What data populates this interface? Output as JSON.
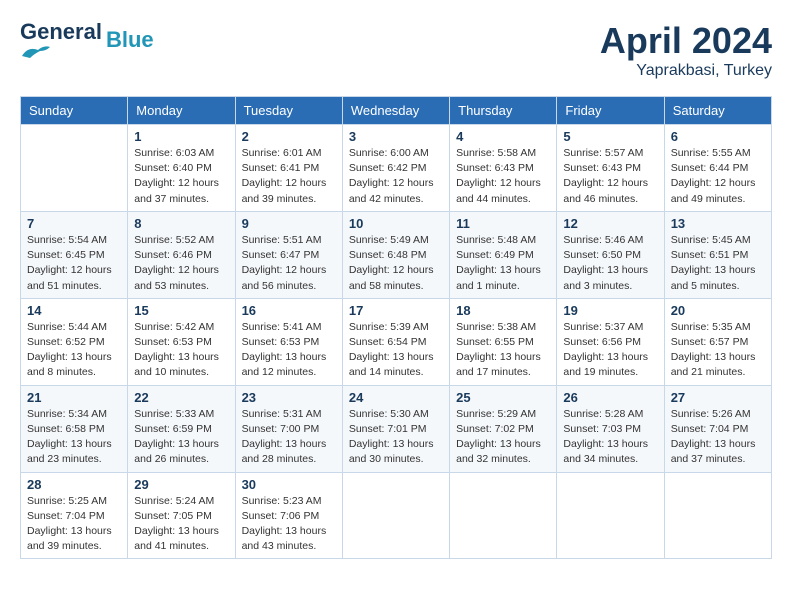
{
  "header": {
    "logo_line1": "General",
    "logo_line2": "Blue",
    "month": "April 2024",
    "location": "Yaprakbasi, Turkey"
  },
  "weekdays": [
    "Sunday",
    "Monday",
    "Tuesday",
    "Wednesday",
    "Thursday",
    "Friday",
    "Saturday"
  ],
  "weeks": [
    [
      {
        "day": "",
        "info": ""
      },
      {
        "day": "1",
        "info": "Sunrise: 6:03 AM\nSunset: 6:40 PM\nDaylight: 12 hours\nand 37 minutes."
      },
      {
        "day": "2",
        "info": "Sunrise: 6:01 AM\nSunset: 6:41 PM\nDaylight: 12 hours\nand 39 minutes."
      },
      {
        "day": "3",
        "info": "Sunrise: 6:00 AM\nSunset: 6:42 PM\nDaylight: 12 hours\nand 42 minutes."
      },
      {
        "day": "4",
        "info": "Sunrise: 5:58 AM\nSunset: 6:43 PM\nDaylight: 12 hours\nand 44 minutes."
      },
      {
        "day": "5",
        "info": "Sunrise: 5:57 AM\nSunset: 6:43 PM\nDaylight: 12 hours\nand 46 minutes."
      },
      {
        "day": "6",
        "info": "Sunrise: 5:55 AM\nSunset: 6:44 PM\nDaylight: 12 hours\nand 49 minutes."
      }
    ],
    [
      {
        "day": "7",
        "info": "Sunrise: 5:54 AM\nSunset: 6:45 PM\nDaylight: 12 hours\nand 51 minutes."
      },
      {
        "day": "8",
        "info": "Sunrise: 5:52 AM\nSunset: 6:46 PM\nDaylight: 12 hours\nand 53 minutes."
      },
      {
        "day": "9",
        "info": "Sunrise: 5:51 AM\nSunset: 6:47 PM\nDaylight: 12 hours\nand 56 minutes."
      },
      {
        "day": "10",
        "info": "Sunrise: 5:49 AM\nSunset: 6:48 PM\nDaylight: 12 hours\nand 58 minutes."
      },
      {
        "day": "11",
        "info": "Sunrise: 5:48 AM\nSunset: 6:49 PM\nDaylight: 13 hours\nand 1 minute."
      },
      {
        "day": "12",
        "info": "Sunrise: 5:46 AM\nSunset: 6:50 PM\nDaylight: 13 hours\nand 3 minutes."
      },
      {
        "day": "13",
        "info": "Sunrise: 5:45 AM\nSunset: 6:51 PM\nDaylight: 13 hours\nand 5 minutes."
      }
    ],
    [
      {
        "day": "14",
        "info": "Sunrise: 5:44 AM\nSunset: 6:52 PM\nDaylight: 13 hours\nand 8 minutes."
      },
      {
        "day": "15",
        "info": "Sunrise: 5:42 AM\nSunset: 6:53 PM\nDaylight: 13 hours\nand 10 minutes."
      },
      {
        "day": "16",
        "info": "Sunrise: 5:41 AM\nSunset: 6:53 PM\nDaylight: 13 hours\nand 12 minutes."
      },
      {
        "day": "17",
        "info": "Sunrise: 5:39 AM\nSunset: 6:54 PM\nDaylight: 13 hours\nand 14 minutes."
      },
      {
        "day": "18",
        "info": "Sunrise: 5:38 AM\nSunset: 6:55 PM\nDaylight: 13 hours\nand 17 minutes."
      },
      {
        "day": "19",
        "info": "Sunrise: 5:37 AM\nSunset: 6:56 PM\nDaylight: 13 hours\nand 19 minutes."
      },
      {
        "day": "20",
        "info": "Sunrise: 5:35 AM\nSunset: 6:57 PM\nDaylight: 13 hours\nand 21 minutes."
      }
    ],
    [
      {
        "day": "21",
        "info": "Sunrise: 5:34 AM\nSunset: 6:58 PM\nDaylight: 13 hours\nand 23 minutes."
      },
      {
        "day": "22",
        "info": "Sunrise: 5:33 AM\nSunset: 6:59 PM\nDaylight: 13 hours\nand 26 minutes."
      },
      {
        "day": "23",
        "info": "Sunrise: 5:31 AM\nSunset: 7:00 PM\nDaylight: 13 hours\nand 28 minutes."
      },
      {
        "day": "24",
        "info": "Sunrise: 5:30 AM\nSunset: 7:01 PM\nDaylight: 13 hours\nand 30 minutes."
      },
      {
        "day": "25",
        "info": "Sunrise: 5:29 AM\nSunset: 7:02 PM\nDaylight: 13 hours\nand 32 minutes."
      },
      {
        "day": "26",
        "info": "Sunrise: 5:28 AM\nSunset: 7:03 PM\nDaylight: 13 hours\nand 34 minutes."
      },
      {
        "day": "27",
        "info": "Sunrise: 5:26 AM\nSunset: 7:04 PM\nDaylight: 13 hours\nand 37 minutes."
      }
    ],
    [
      {
        "day": "28",
        "info": "Sunrise: 5:25 AM\nSunset: 7:04 PM\nDaylight: 13 hours\nand 39 minutes."
      },
      {
        "day": "29",
        "info": "Sunrise: 5:24 AM\nSunset: 7:05 PM\nDaylight: 13 hours\nand 41 minutes."
      },
      {
        "day": "30",
        "info": "Sunrise: 5:23 AM\nSunset: 7:06 PM\nDaylight: 13 hours\nand 43 minutes."
      },
      {
        "day": "",
        "info": ""
      },
      {
        "day": "",
        "info": ""
      },
      {
        "day": "",
        "info": ""
      },
      {
        "day": "",
        "info": ""
      }
    ]
  ]
}
